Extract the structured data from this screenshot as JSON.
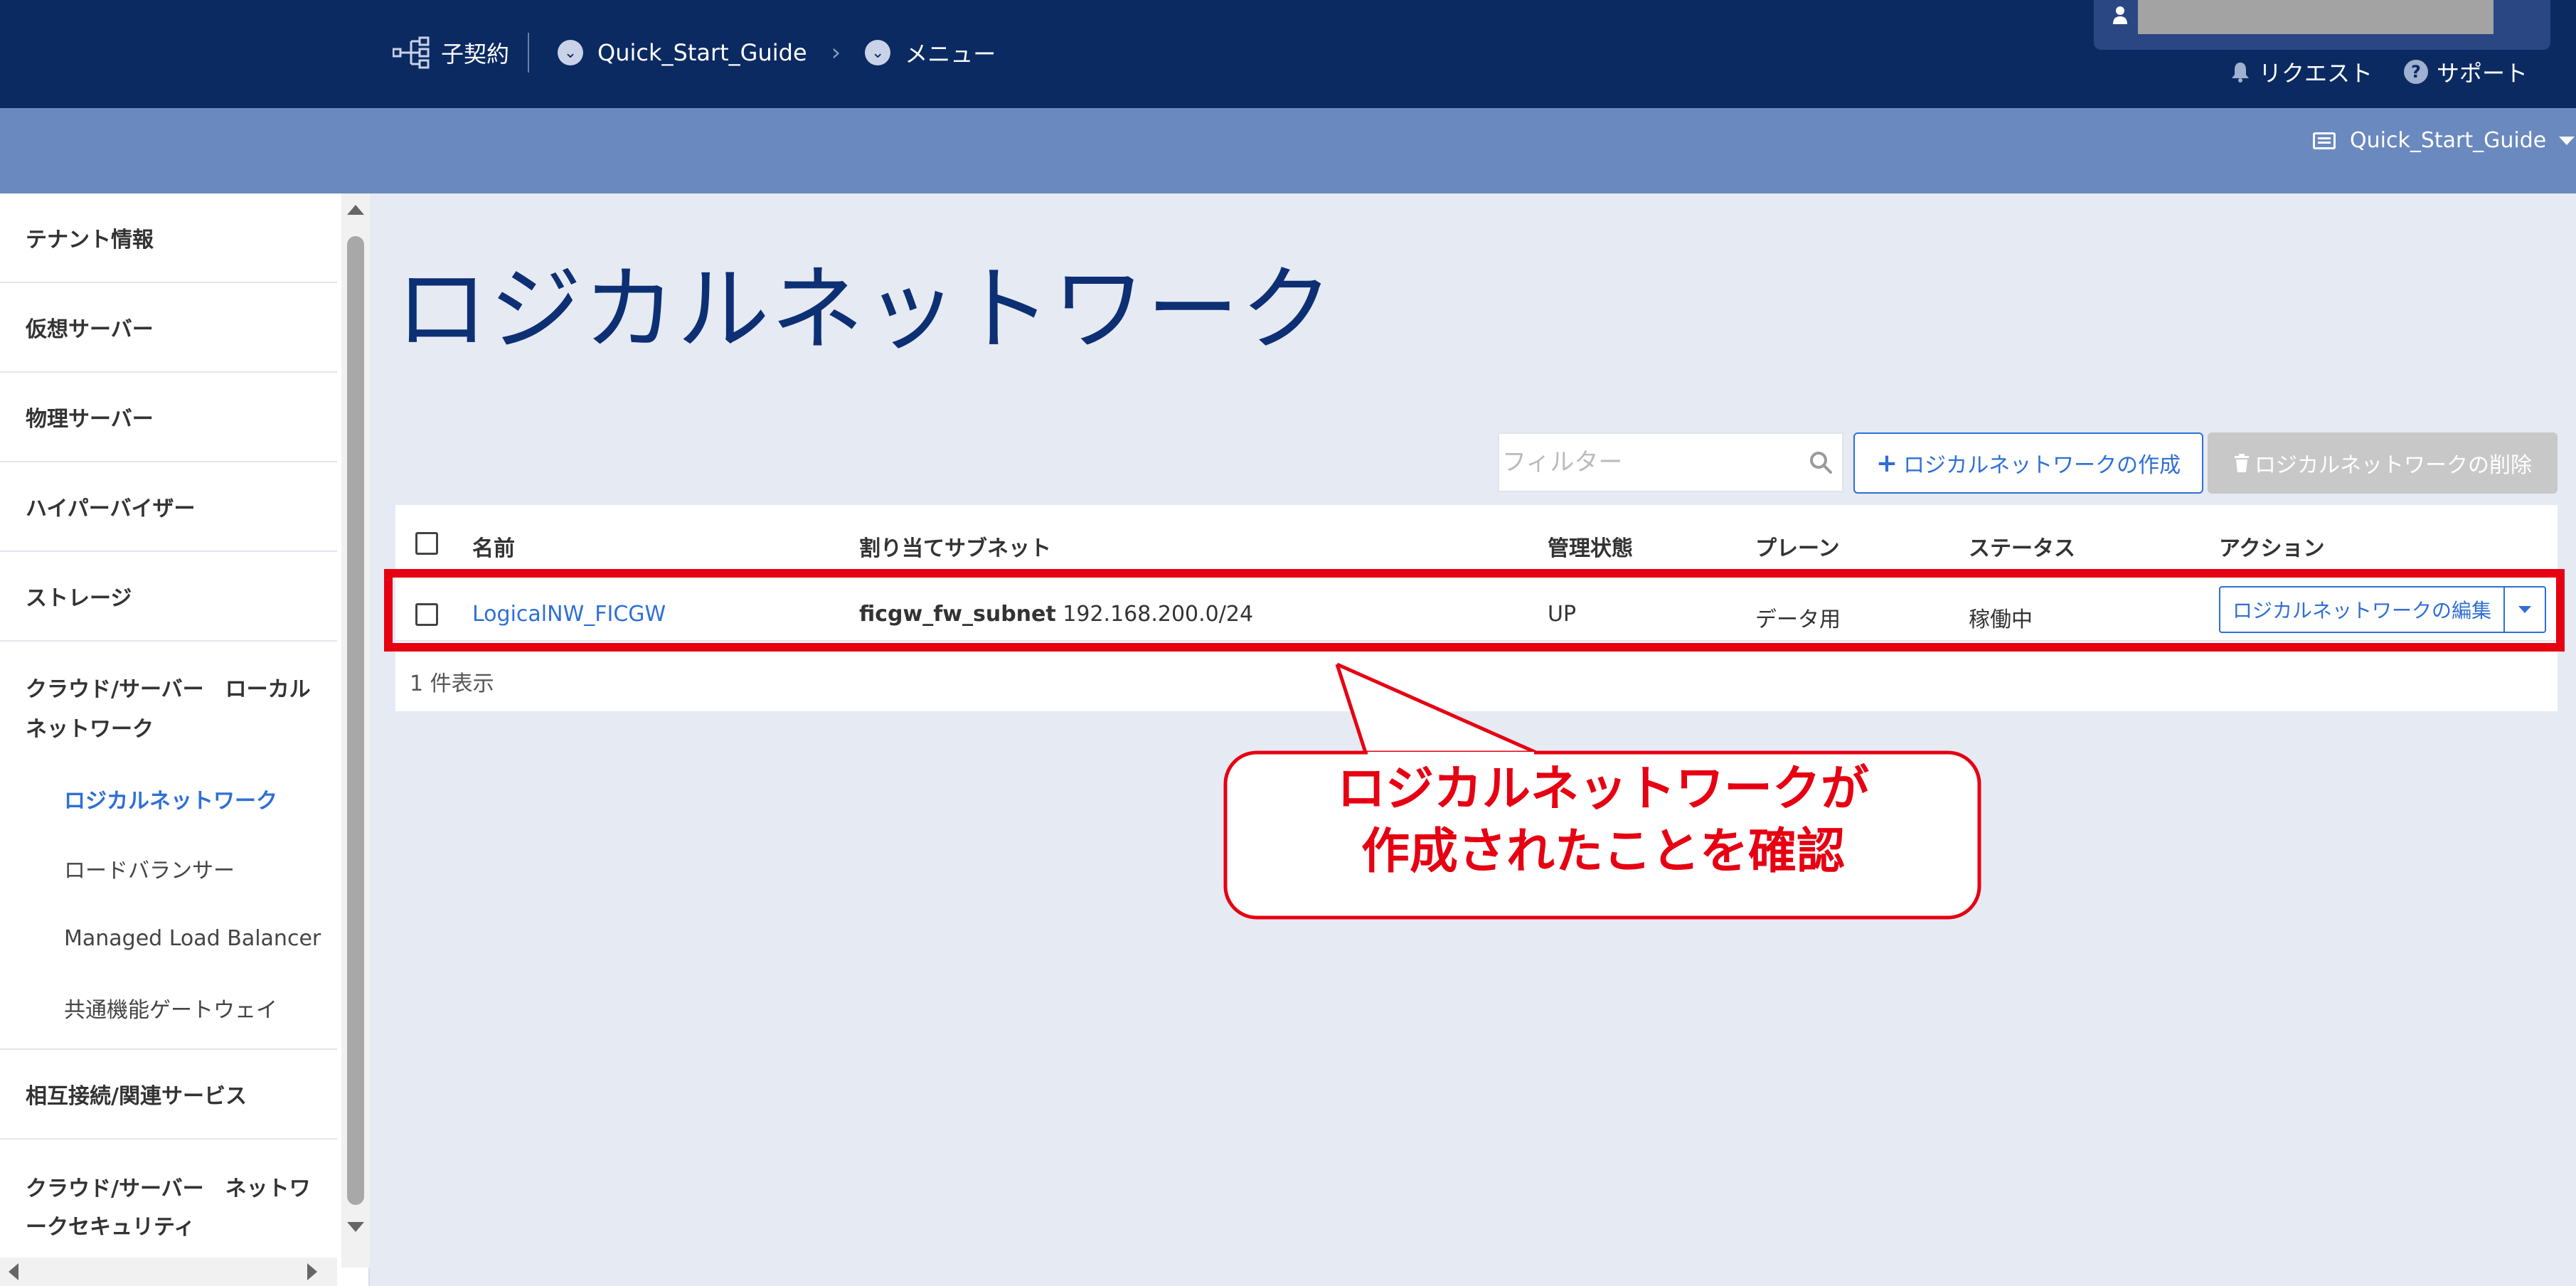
{
  "header": {
    "breadcrumb": [
      {
        "label": "子契約",
        "icon": "tree-icon"
      },
      {
        "label": "Quick_Start_Guide",
        "icon": "chevron-circle-icon"
      },
      {
        "label": "メニュー",
        "icon": "chevron-circle-icon"
      }
    ],
    "user_icon": "user-icon",
    "request_label": "リクエスト",
    "support_label": "サポート",
    "support_icon_glyph": "?"
  },
  "subbar": {
    "project_label": "Quick_Start_Guide"
  },
  "sidebar": {
    "items": [
      {
        "label": "テナント情報"
      },
      {
        "label": "仮想サーバー"
      },
      {
        "label": "物理サーバー"
      },
      {
        "label": "ハイパーバイザー"
      },
      {
        "label": "ストレージ"
      },
      {
        "label": "クラウド/サーバー　ローカルネットワーク"
      },
      {
        "label": "相互接続/関連サービス"
      },
      {
        "label": "クラウド/サーバー　ネットワークセキュリティ"
      }
    ],
    "subitems": [
      {
        "label": "ロジカルネットワーク",
        "active": true
      },
      {
        "label": "ロードバランサー"
      },
      {
        "label": "Managed Load Balancer"
      },
      {
        "label": "共通機能ゲートウェイ"
      }
    ]
  },
  "main": {
    "title": "ロジカルネットワーク",
    "filter_placeholder": "フィルター",
    "create_button": "ロジカルネットワークの作成",
    "create_plus": "+",
    "delete_button": "ロジカルネットワークの削除",
    "table": {
      "columns": [
        "名前",
        "割り当てサブネット",
        "管理状態",
        "プレーン",
        "ステータス",
        "アクション"
      ],
      "rows": [
        {
          "name": "LogicalNW_FICGW",
          "subnet_name": "ficgw_fw_subnet",
          "subnet_cidr": "192.168.200.0/24",
          "admin_state": "UP",
          "plane": "データ用",
          "status": "稼働中",
          "action": "ロジカルネットワークの編集"
        }
      ],
      "count_text": "1 件表示"
    }
  },
  "annotation": {
    "line1": "ロジカルネットワークが",
    "line2": "作成されたことを確認",
    "color": "#e60012"
  },
  "colors": {
    "navy": "#0b2a62",
    "subbar": "#6a89bf",
    "link": "#2f6fd6",
    "title": "#0d2f74"
  }
}
